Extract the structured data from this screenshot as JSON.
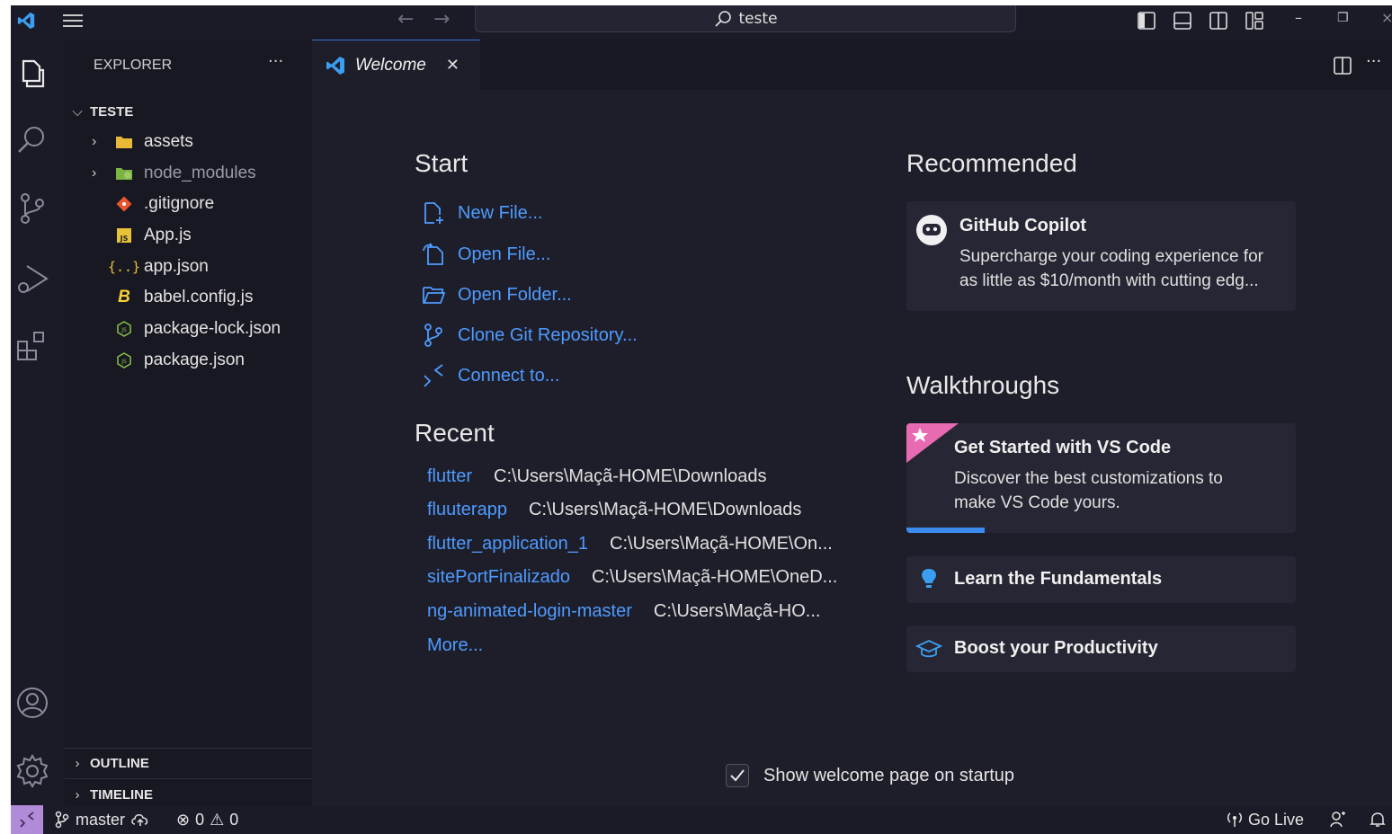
{
  "titlebar": {
    "search_text": "teste"
  },
  "sidebar": {
    "title": "EXPLORER",
    "more": "···",
    "folder": "TESTE",
    "items": [
      {
        "label": "assets",
        "icon": "folder-icon"
      },
      {
        "label": "node_modules",
        "icon": "folder-node-icon"
      },
      {
        "label": ".gitignore",
        "icon": "git-icon"
      },
      {
        "label": "App.js",
        "icon": "js-file-icon"
      },
      {
        "label": "app.json",
        "icon": "json-icon"
      },
      {
        "label": "babel.config.js",
        "icon": "babel-icon"
      },
      {
        "label": "package-lock.json",
        "icon": "node-json-icon"
      },
      {
        "label": "package.json",
        "icon": "node-json-icon"
      }
    ],
    "outline": "OUTLINE",
    "timeline": "TIMELINE"
  },
  "tab": {
    "label": "Welcome",
    "close": "✕"
  },
  "welcome": {
    "start_title": "Start",
    "start_links": [
      {
        "label": "New File...",
        "icon": "new-file-icon"
      },
      {
        "label": "Open File...",
        "icon": "open-file-icon"
      },
      {
        "label": "Open Folder...",
        "icon": "open-folder-icon"
      },
      {
        "label": "Clone Git Repository...",
        "icon": "git-branch-icon"
      },
      {
        "label": "Connect to...",
        "icon": "remote-icon"
      }
    ],
    "recent_title": "Recent",
    "recent": [
      {
        "name": "flutter",
        "path": "C:\\Users\\Maçã-HOME\\Downloads"
      },
      {
        "name": "fluuterapp",
        "path": "C:\\Users\\Maçã-HOME\\Downloads"
      },
      {
        "name": "flutter_application_1",
        "path": "C:\\Users\\Maçã-HOME\\On..."
      },
      {
        "name": "sitePortFinalizado",
        "path": "C:\\Users\\Maçã-HOME\\OneD..."
      },
      {
        "name": "ng-animated-login-master",
        "path": "C:\\Users\\Maçã-HO..."
      }
    ],
    "more": "More...",
    "recommended_title": "Recommended",
    "copilot": {
      "title": "GitHub Copilot",
      "desc_line1": "Supercharge your coding experience for",
      "desc_line2": "as little as $10/month with cutting edg..."
    },
    "walkthroughs_title": "Walkthroughs",
    "walkthroughs": {
      "get_started_title": "Get Started with VS Code",
      "get_started_desc1": "Discover the best customizations to",
      "get_started_desc2": "make VS Code yours.",
      "get_started_progress": 0.2,
      "fundamentals": "Learn the Fundamentals",
      "productivity": "Boost your Productivity"
    },
    "show_on_startup": "Show welcome page on startup",
    "show_on_startup_checked": true
  },
  "statusbar": {
    "branch": "master",
    "errors": "0",
    "warnings": "0",
    "golive": "Go Live"
  },
  "colors": {
    "accent": "#4e9bff",
    "remote": "#b18bd8",
    "background": "#1e1e2a"
  }
}
